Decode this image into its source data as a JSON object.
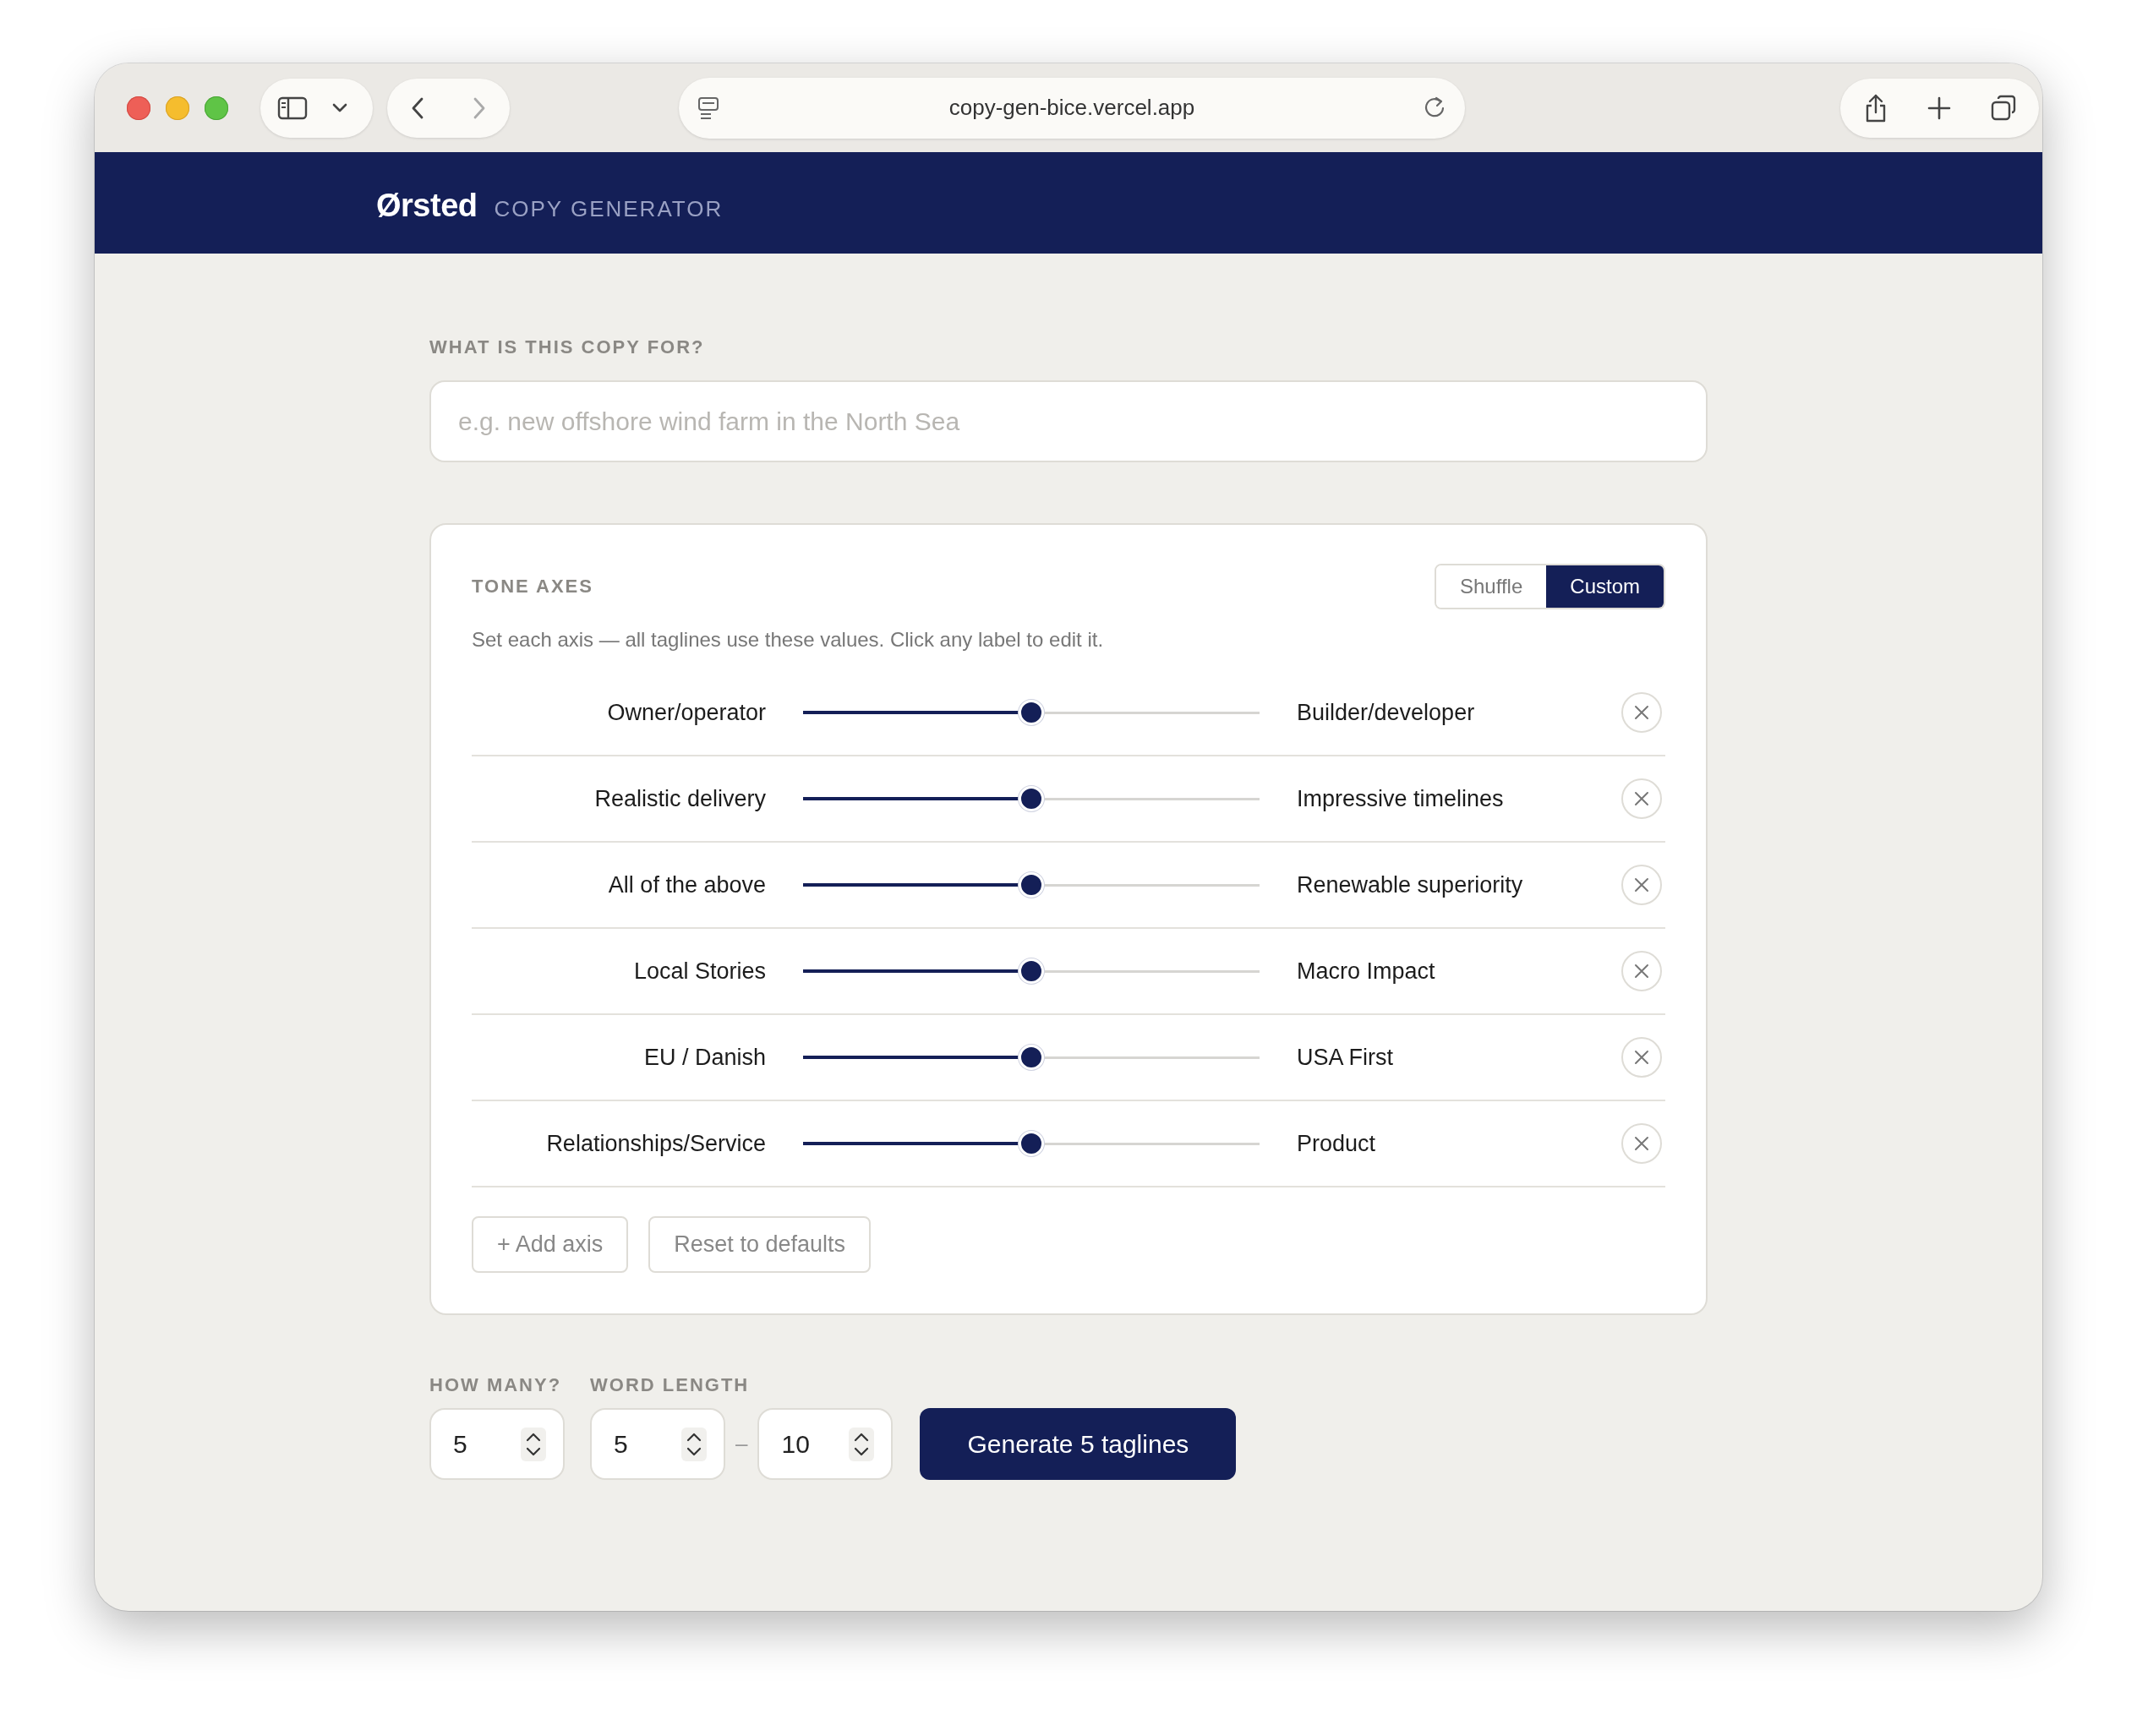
{
  "browser": {
    "url": "copy-gen-bice.vercel.app"
  },
  "header": {
    "brand": "Ørsted",
    "title": "COPY GENERATOR"
  },
  "purpose": {
    "label": "WHAT IS THIS COPY FOR?",
    "placeholder": "e.g. new offshore wind farm in the North Sea"
  },
  "tone": {
    "title": "TONE AXES",
    "modes": [
      {
        "label": "Shuffle",
        "selected": false
      },
      {
        "label": "Custom",
        "selected": true
      }
    ],
    "hint": "Set each axis — all taglines use these values. Click any label to edit it.",
    "axes": [
      {
        "left": "Owner/operator",
        "right": "Builder/developer",
        "level": 0.5
      },
      {
        "left": "Realistic delivery",
        "right": "Impressive timelines",
        "level": 0.5
      },
      {
        "left": "All of the above",
        "right": "Renewable superiority",
        "level": 0.5
      },
      {
        "left": "Local Stories",
        "right": "Macro Impact",
        "level": 0.5
      },
      {
        "left": "EU / Danish",
        "right": "USA First",
        "level": 0.5
      },
      {
        "left": "Relationships/Service",
        "right": "Product",
        "level": 0.5
      }
    ],
    "buttons": [
      "+ Add axis",
      "Reset to defaults"
    ]
  },
  "how_many": {
    "label": "HOW MANY?",
    "value": "5"
  },
  "word_length": {
    "label": "WORD LENGTH",
    "min": "5",
    "separator": "–",
    "max": "10"
  },
  "generate": "Generate 5 taglines"
}
